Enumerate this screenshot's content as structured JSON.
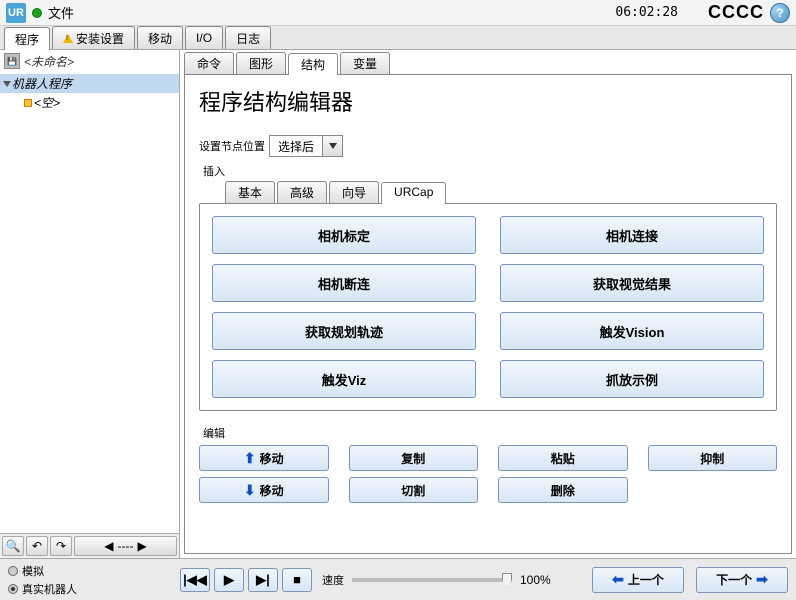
{
  "topbar": {
    "file": "文件",
    "clock": "06:02:28",
    "cccc": "CCCC",
    "help": "?"
  },
  "main_tabs": {
    "program": "程序",
    "install": "安装设置",
    "move": "移动",
    "io": "I/O",
    "log": "日志"
  },
  "left": {
    "doc_title": "<未命名>",
    "tree": {
      "root": "机器人程序",
      "empty": "<空>"
    },
    "magnifier": "🔍"
  },
  "rp_tabs": {
    "cmd": "命令",
    "graphic": "图形",
    "struct": "结构",
    "var": "变量"
  },
  "editor": {
    "title": "程序结构编辑器",
    "pos_label": "设置节点位置",
    "pos_value": "选择后",
    "insert_label": "插入",
    "insert_tabs": {
      "basic": "基本",
      "adv": "高级",
      "wizard": "向导",
      "urcap": "URCap"
    },
    "buttons": {
      "b0": "相机标定",
      "b1": "相机连接",
      "b2": "相机断连",
      "b3": "获取视觉结果",
      "b4": "获取规划轨迹",
      "b5": "触发Vision",
      "b6": "触发Viz",
      "b7": "抓放示例"
    },
    "edit_label": "编辑",
    "edit_buttons": {
      "move_up": "移动",
      "move_down": "移动",
      "copy": "复制",
      "cut": "切割",
      "paste": "粘贴",
      "delete": "删除",
      "suppress": "抑制"
    }
  },
  "bottom": {
    "sim": "模拟",
    "real": "真实机器人",
    "speed_label": "速度",
    "speed_value": "100%",
    "prev": "上一个",
    "next": "下一个"
  }
}
